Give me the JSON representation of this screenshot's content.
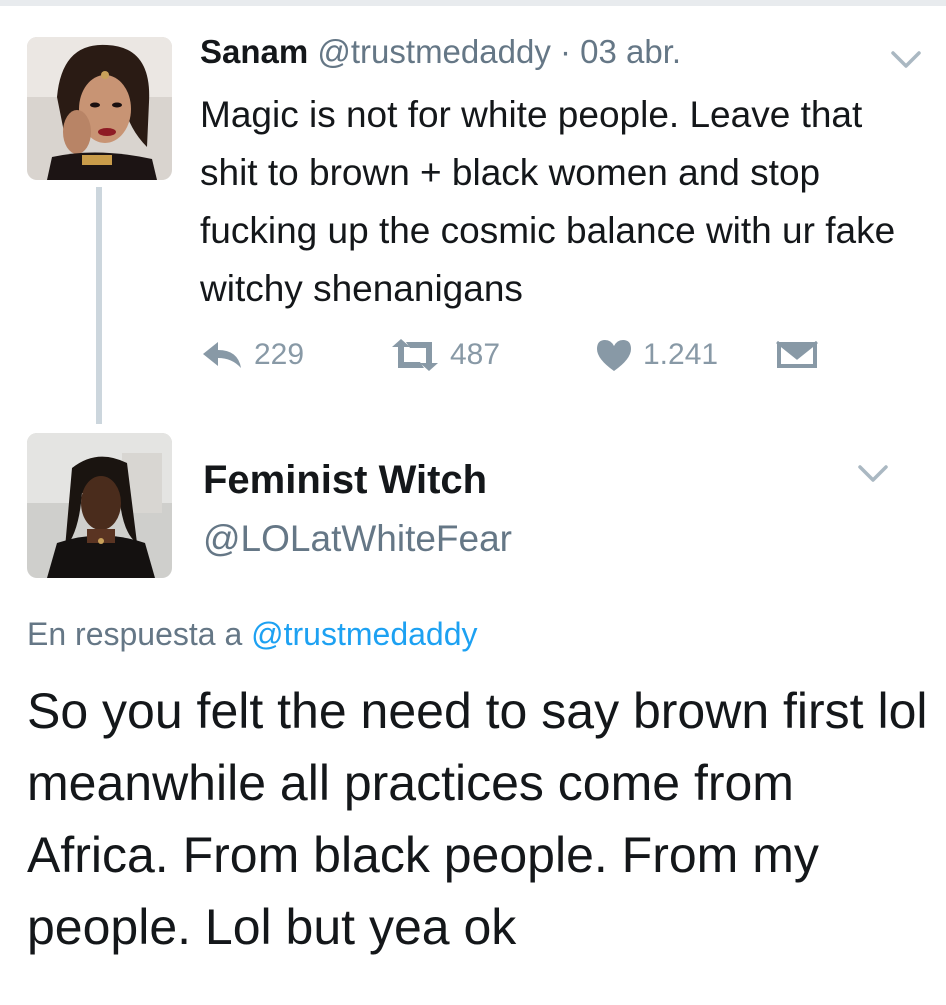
{
  "tweet1": {
    "display_name": "Sanam",
    "handle": "@trustmedaddy",
    "separator": "·",
    "date": "03 abr.",
    "text": "Magic is not for white people. Leave that shit to brown + black women and stop fucking up the cosmic balance with ur fake witchy shenanigans",
    "avatar_icon": "profile-photo",
    "menu_icon": "chevron-down-icon",
    "actions": {
      "reply_icon": "reply-icon",
      "reply_count": "229",
      "retweet_icon": "retweet-icon",
      "retweet_count": "487",
      "like_icon": "heart-icon",
      "like_count": "1.241",
      "dm_icon": "direct-message-icon"
    }
  },
  "tweet2": {
    "display_name": "Feminist Witch",
    "handle": "@LOLatWhiteFear",
    "reply_prefix": "En respuesta a",
    "reply_mention": "@trustmedaddy",
    "text": "So you felt the need to say brown first lol meanwhile all practices come from Africa. From black people. From my people. Lol but yea ok",
    "avatar_icon": "profile-photo",
    "menu_icon": "chevron-down-icon"
  },
  "colors": {
    "text_primary": "#14171a",
    "text_secondary": "#657786",
    "action_gray": "#8899a6",
    "link_blue": "#1da1f2",
    "thread_line": "#ccd6dd"
  }
}
